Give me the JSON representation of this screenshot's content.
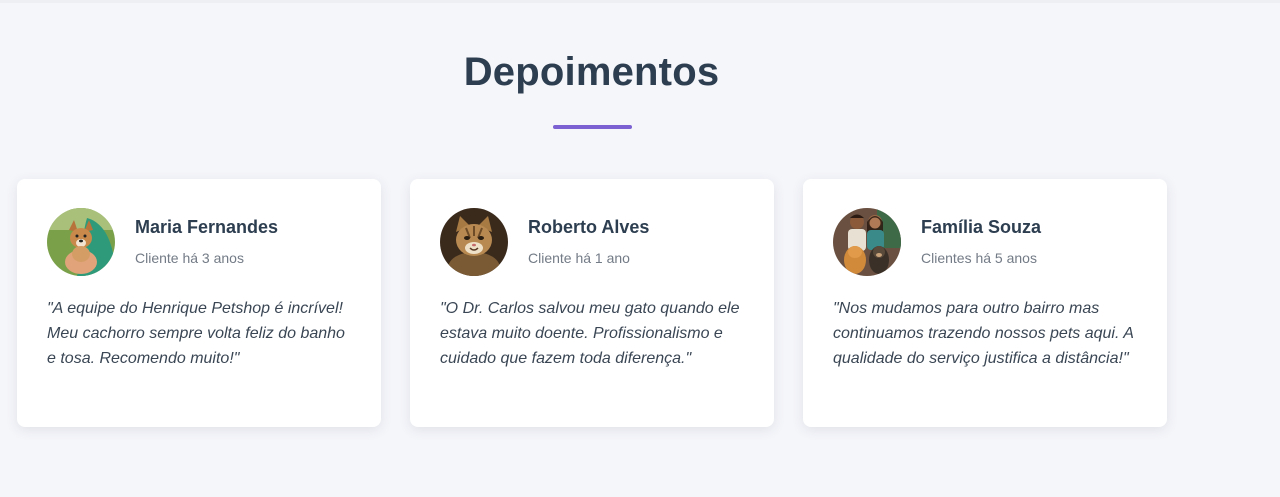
{
  "section": {
    "title": "Depoimentos",
    "accent_color": "#7b61d1"
  },
  "testimonials": [
    {
      "name": "Maria Fernandes",
      "since": "Cliente há 3 anos",
      "quote": "\"A equipe do Henrique Petshop é incrível! Meu cachorro sempre volta feliz do banho e tosa. Recomendo muito!\"",
      "avatar": "dog-photo-avatar"
    },
    {
      "name": "Roberto Alves",
      "since": "Cliente há 1 ano",
      "quote": "\"O Dr. Carlos salvou meu gato quando ele estava muito doente. Profissionalismo e cuidado que fazem toda diferença.\"",
      "avatar": "cat-photo-avatar"
    },
    {
      "name": "Família Souza",
      "since": "Clientes há 5 anos",
      "quote": "\"Nos mudamos para outro bairro mas continuamos trazendo nossos pets aqui. A qualidade do serviço justifica a distância!\"",
      "avatar": "family-photo-avatar"
    }
  ]
}
